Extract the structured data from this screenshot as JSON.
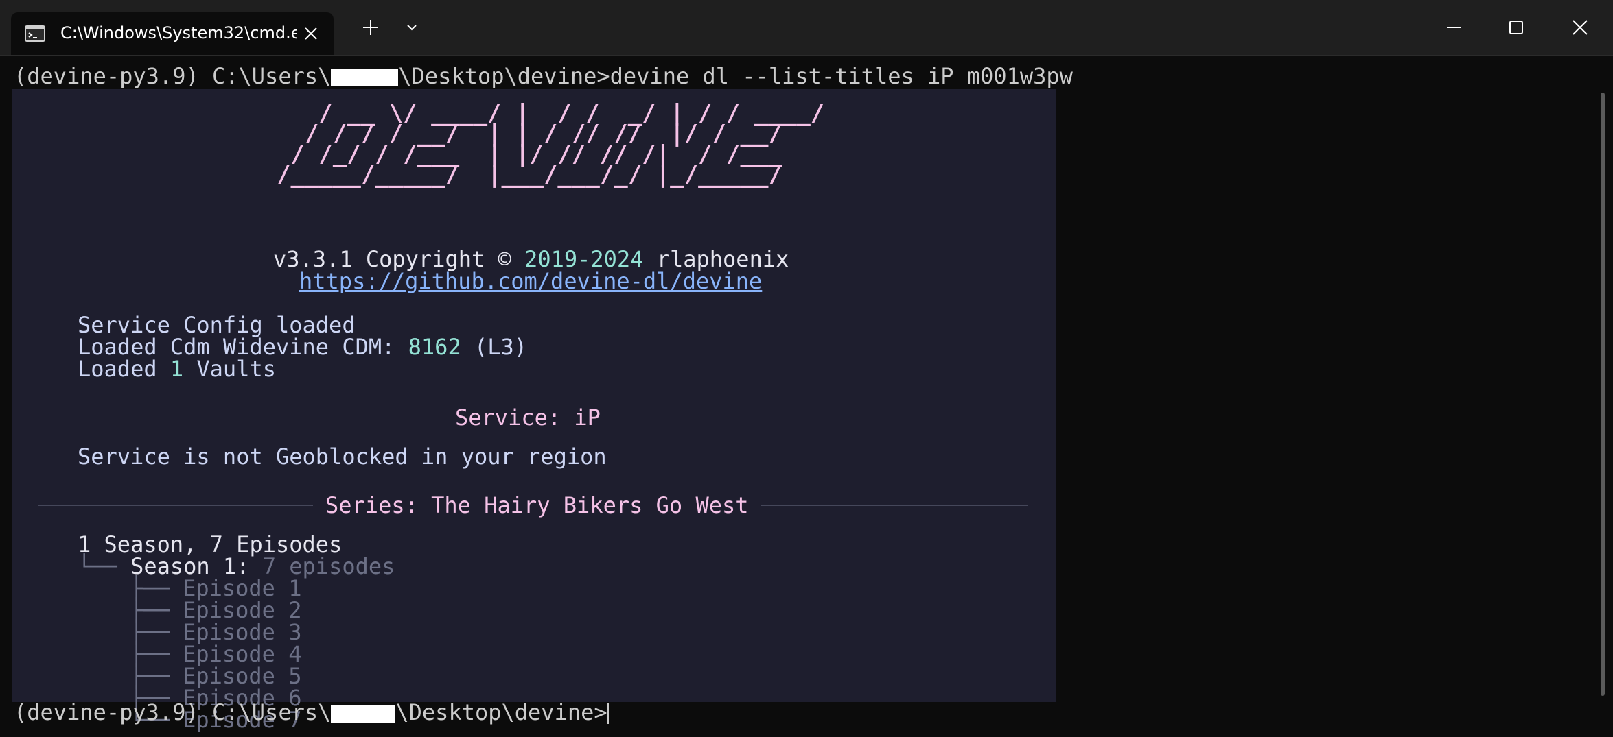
{
  "window": {
    "tab_title": "C:\\Windows\\System32\\cmd.e",
    "icons": {
      "tab": "terminal-icon",
      "close_tab": "close-icon",
      "new_tab": "plus-icon",
      "dropdown": "chevron-down-icon",
      "minimize": "minimize-icon",
      "maximize": "maximize-icon",
      "close_window": "close-icon"
    }
  },
  "prompt": {
    "prefix": "(devine-py3.9) C:\\Users\\",
    "suffix": "\\Desktop\\devine>",
    "command": "devine dl --list-titles iP m001w3pw"
  },
  "banner": {
    "art": "   / __ \\/ ____/ |  / /  _/ | / / ____/\n  / / / / __/  | | / // //  |/ / __/\n / /_/ / /___  | |/ // // /|  / /___\n/_____/_____/  |___/___/_/ |_/_____/",
    "version": "v3.3.1",
    "copyright_text": " Copyright © ",
    "years": "2019-2024",
    "author": " rlaphoenix",
    "url": "https://github.com/devine-dl/devine"
  },
  "logs": {
    "config": "Service Config loaded",
    "cdm_prefix": "Loaded Cdm Widevine CDM: ",
    "cdm_id": "8162",
    "cdm_level": " (L3)",
    "vaults_prefix": "Loaded ",
    "vaults_count": "1",
    "vaults_suffix": " Vaults"
  },
  "service": {
    "rule_label": "Service: iP",
    "geo_status": "Service is not Geoblocked in your region"
  },
  "series": {
    "rule_label": "Series: The Hairy Bikers Go West",
    "summary": "1 Season, 7 Episodes",
    "season_branch": "└── ",
    "season_label": "Season 1:",
    "season_count": " 7 episodes",
    "episodes": [
      {
        "branch": "├── ",
        "label": "Episode 1"
      },
      {
        "branch": "├── ",
        "label": "Episode 2"
      },
      {
        "branch": "├── ",
        "label": "Episode 3"
      },
      {
        "branch": "├── ",
        "label": "Episode 4"
      },
      {
        "branch": "├── ",
        "label": "Episode 5"
      },
      {
        "branch": "├── ",
        "label": "Episode 6"
      },
      {
        "branch": "└── ",
        "label": "Episode 7"
      }
    ]
  },
  "colors": {
    "terminal_bg": "#0c0c0c",
    "panel_bg": "#1e1e2e",
    "accent_pink": "#f5c2e7",
    "accent_teal": "#94e2d5",
    "link_blue": "#89b4fa",
    "dim_text": "#6c7086"
  }
}
